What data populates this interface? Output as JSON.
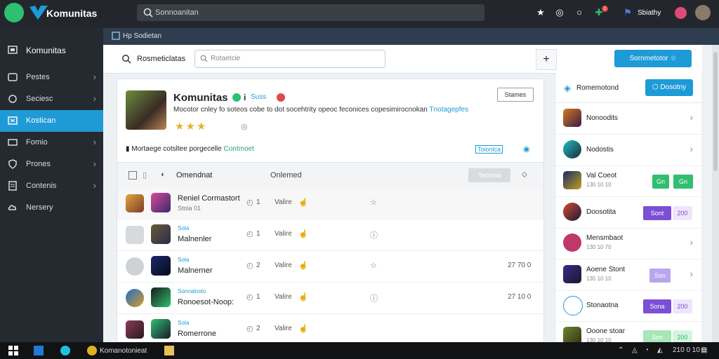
{
  "colors": {
    "accent": "#1e9bd7",
    "green": "#2fbf71",
    "purple": "#7b4fd6"
  },
  "topbar": {
    "brand": "Komunitas",
    "search_text": "Sonnoanitan",
    "user_label": "Sbiathy",
    "notif_count": "1"
  },
  "sidebar": {
    "header": "Komunitas",
    "items": [
      {
        "label": "Pestes",
        "icon": "gamepad-icon"
      },
      {
        "label": "Seciesc",
        "icon": "controller-icon"
      },
      {
        "label": "Kostican",
        "icon": "store-icon"
      },
      {
        "label": "Fomio",
        "icon": "folder-icon"
      },
      {
        "label": "Prones",
        "icon": "shield-icon"
      },
      {
        "label": "Contenis",
        "icon": "content-icon"
      },
      {
        "label": "Nersery",
        "icon": "cloud-icon"
      }
    ]
  },
  "breadcrumb": {
    "text": "Hp Sodietan"
  },
  "toolbar": {
    "title": "Rosmeticlatas",
    "search_placeholder": "Rotaetcie",
    "new_button": "Sornmetotor"
  },
  "card": {
    "title": "Komunitas",
    "badge_text": "Suss",
    "description": "Mocotor cnley fo soteos cobe to dot socehtrity opeoc feconices copesimirocnokan",
    "description_link": "Tnotagepfes",
    "button": "Stames",
    "rating_stars": 3,
    "sub_text": "Mortaege cotsltee porgecelle",
    "sub_green": "Contmoet",
    "sub_link": "Toionlca",
    "header_col1": "Omendnat",
    "header_col2": "Onlemed",
    "header_button": "Teomna"
  },
  "rows": [
    {
      "tag": "",
      "name": "Reniel Cormastort",
      "sub": "Stoia 01",
      "count": "1",
      "value": "Valire",
      "num": ""
    },
    {
      "tag": "Sota",
      "name": "Malnenler",
      "sub": "",
      "count": "1",
      "value": "Valire",
      "num": ""
    },
    {
      "tag": "Sota",
      "name": "Malnerner",
      "sub": "",
      "count": "2",
      "value": "Valire",
      "num": "27 70 0"
    },
    {
      "tag": "Sonnalnoto",
      "name": "Ronoesot-Noop:",
      "sub": "",
      "count": "1",
      "value": "Valire",
      "num": "27 10 0"
    },
    {
      "tag": "Sota",
      "name": "Romerrone",
      "sub": "",
      "count": "2",
      "value": "Valire",
      "num": ""
    }
  ],
  "panel": {
    "title": "Romemotond",
    "button": "Dosotny",
    "items": [
      {
        "title": "Nonoodits",
        "sub": "",
        "buttons": []
      },
      {
        "title": "Nodostis",
        "sub": "",
        "buttons": []
      },
      {
        "title": "Val Coeot",
        "sub": "130 10 10",
        "buttons": [
          "Gn",
          "Gn"
        ]
      },
      {
        "title": "Doosotita",
        "sub": "",
        "buttons": [
          "Sont",
          "200"
        ]
      },
      {
        "title": "Mensmbaot",
        "sub": "130 10 70",
        "buttons": []
      },
      {
        "title": "Aoene Stont",
        "sub": "135 10 10",
        "buttons": [
          "Son"
        ]
      },
      {
        "title": "Stonaotna",
        "sub": "",
        "buttons": [
          "Sona",
          "200"
        ]
      },
      {
        "title": "Ooone stoar",
        "sub": "130 10 10",
        "buttons": [
          "Son",
          "200"
        ]
      }
    ]
  },
  "taskbar": {
    "app_label": "Komanotonieat",
    "clock": "210 0 10 0"
  }
}
